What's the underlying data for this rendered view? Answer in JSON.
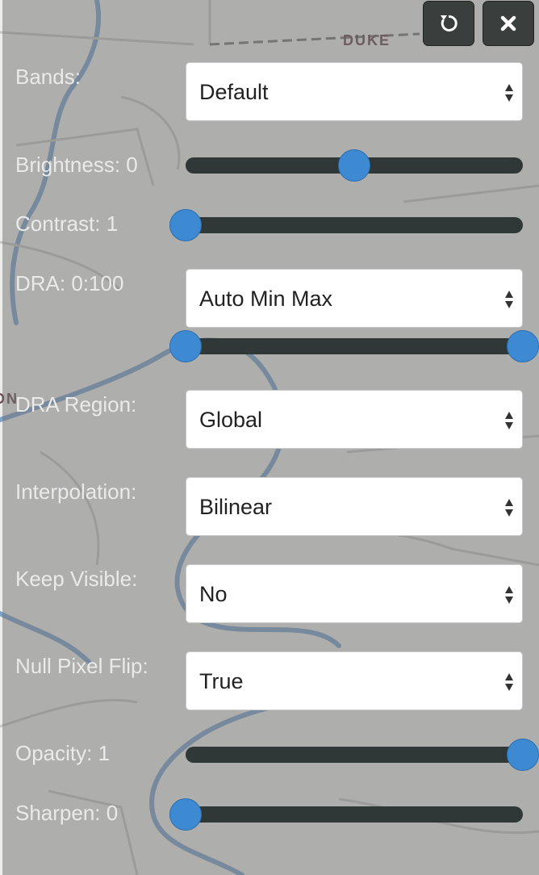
{
  "header": {
    "reset_icon": "reset-icon",
    "close_icon": "close-icon"
  },
  "map": {
    "street_label": "DUKE",
    "partial_label": "ON"
  },
  "fields": {
    "bands": {
      "label": "Bands:",
      "value": "Default"
    },
    "brightness": {
      "label": "Brightness: 0",
      "level": 0.5
    },
    "contrast": {
      "label": "Contrast: 1",
      "level": 0.0
    },
    "dra": {
      "label": "DRA: 0:100",
      "value": "Auto Min Max",
      "range": [
        0,
        100
      ]
    },
    "dra_region": {
      "label": "DRA Region:",
      "value": "Global"
    },
    "interpolation": {
      "label": "Interpolation:",
      "value": "Bilinear"
    },
    "keep_visible": {
      "label": "Keep Visible:",
      "value": "No"
    },
    "null_pixel_flip": {
      "label": "Null Pixel Flip:",
      "value": "True"
    },
    "opacity": {
      "label": "Opacity: 1",
      "level": 1.0
    },
    "sharpen": {
      "label": "Sharpen: 0",
      "level": 0.0
    }
  },
  "colors": {
    "accent": "#3d8ad3",
    "track": "#2f3836",
    "panel": "#707070"
  }
}
